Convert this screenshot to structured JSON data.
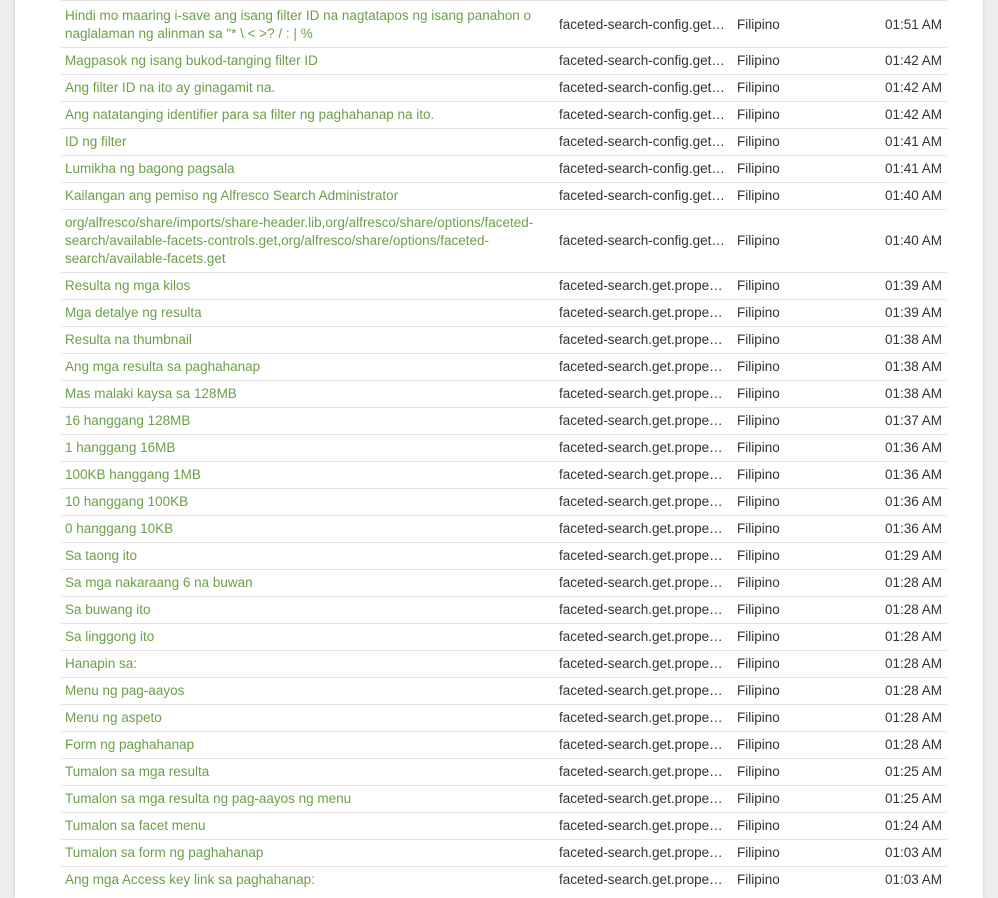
{
  "accent_color": "#6d9f49",
  "rows": [
    {
      "text": "Hindi mo maaring i-save ang isang filter ID na nagtatapos ng isang panahon o naglalaman ng alinman sa \"* \\ < >? / : | %",
      "file": "faceted-search-config.get.properties",
      "language": "Filipino",
      "time": "01:51 AM"
    },
    {
      "text": "Magpasok ng isang bukod-tanging filter ID",
      "file": "faceted-search-config.get.properties",
      "language": "Filipino",
      "time": "01:42 AM"
    },
    {
      "text": "Ang filter ID na ito ay ginagamit na.",
      "file": "faceted-search-config.get.properties",
      "language": "Filipino",
      "time": "01:42 AM"
    },
    {
      "text": "Ang natatanging identifier para sa filter ng paghahanap na ito.",
      "file": "faceted-search-config.get.properties",
      "language": "Filipino",
      "time": "01:42 AM"
    },
    {
      "text": "ID ng filter",
      "file": "faceted-search-config.get.properties",
      "language": "Filipino",
      "time": "01:41 AM"
    },
    {
      "text": "Lumikha ng bagong pagsala",
      "file": "faceted-search-config.get.properties",
      "language": "Filipino",
      "time": "01:41 AM"
    },
    {
      "text": "Kailangan ang pemiso ng Alfresco Search Administrator",
      "file": "faceted-search-config.get.properties",
      "language": "Filipino",
      "time": "01:40 AM"
    },
    {
      "text": "org/alfresco/share/imports/share-header.lib,org/alfresco/share/options/faceted-search/available-facets-controls.get,org/alfresco/share/options/faceted-search/available-facets.get",
      "file": "faceted-search-config.get.properties",
      "language": "Filipino",
      "time": "01:40 AM"
    },
    {
      "text": "Resulta ng mga kilos",
      "file": "faceted-search.get.properties",
      "language": "Filipino",
      "time": "01:39 AM"
    },
    {
      "text": "Mga detalye ng resulta",
      "file": "faceted-search.get.properties",
      "language": "Filipino",
      "time": "01:39 AM"
    },
    {
      "text": "Resulta na thumbnail",
      "file": "faceted-search.get.properties",
      "language": "Filipino",
      "time": "01:38 AM"
    },
    {
      "text": "Ang mga resulta sa paghahanap",
      "file": "faceted-search.get.properties",
      "language": "Filipino",
      "time": "01:38 AM"
    },
    {
      "text": "Mas malaki kaysa sa 128MB",
      "file": "faceted-search.get.properties",
      "language": "Filipino",
      "time": "01:38 AM"
    },
    {
      "text": "16 hanggang 128MB",
      "file": "faceted-search.get.properties",
      "language": "Filipino",
      "time": "01:37 AM"
    },
    {
      "text": "1 hanggang 16MB",
      "file": "faceted-search.get.properties",
      "language": "Filipino",
      "time": "01:36 AM"
    },
    {
      "text": "100KB hanggang 1MB",
      "file": "faceted-search.get.properties",
      "language": "Filipino",
      "time": "01:36 AM"
    },
    {
      "text": "10 hanggang 100KB",
      "file": "faceted-search.get.properties",
      "language": "Filipino",
      "time": "01:36 AM"
    },
    {
      "text": "0 hanggang 10KB",
      "file": "faceted-search.get.properties",
      "language": "Filipino",
      "time": "01:36 AM"
    },
    {
      "text": "Sa taong ito",
      "file": "faceted-search.get.properties",
      "language": "Filipino",
      "time": "01:29 AM"
    },
    {
      "text": "Sa mga nakaraang 6 na buwan",
      "file": "faceted-search.get.properties",
      "language": "Filipino",
      "time": "01:28 AM"
    },
    {
      "text": "Sa buwang ito",
      "file": "faceted-search.get.properties",
      "language": "Filipino",
      "time": "01:28 AM"
    },
    {
      "text": "Sa linggong ito",
      "file": "faceted-search.get.properties",
      "language": "Filipino",
      "time": "01:28 AM"
    },
    {
      "text": "Hanapin sa:",
      "file": "faceted-search.get.properties",
      "language": "Filipino",
      "time": "01:28 AM"
    },
    {
      "text": "Menu ng pag-aayos",
      "file": "faceted-search.get.properties",
      "language": "Filipino",
      "time": "01:28 AM"
    },
    {
      "text": "Menu ng aspeto",
      "file": "faceted-search.get.properties",
      "language": "Filipino",
      "time": "01:28 AM"
    },
    {
      "text": "Form ng paghahanap",
      "file": "faceted-search.get.properties",
      "language": "Filipino",
      "time": "01:28 AM"
    },
    {
      "text": "Tumalon sa mga resulta",
      "file": "faceted-search.get.properties",
      "language": "Filipino",
      "time": "01:25 AM"
    },
    {
      "text": "Tumalon sa mga resulta ng pag-aayos ng menu",
      "file": "faceted-search.get.properties",
      "language": "Filipino",
      "time": "01:25 AM"
    },
    {
      "text": "Tumalon sa facet menu",
      "file": "faceted-search.get.properties",
      "language": "Filipino",
      "time": "01:24 AM"
    },
    {
      "text": "Tumalon sa form ng paghahanap",
      "file": "faceted-search.get.properties",
      "language": "Filipino",
      "time": "01:03 AM"
    },
    {
      "text": "Ang mga Access key link sa paghahanap:",
      "file": "faceted-search.get.properties",
      "language": "Filipino",
      "time": "01:03 AM"
    }
  ]
}
